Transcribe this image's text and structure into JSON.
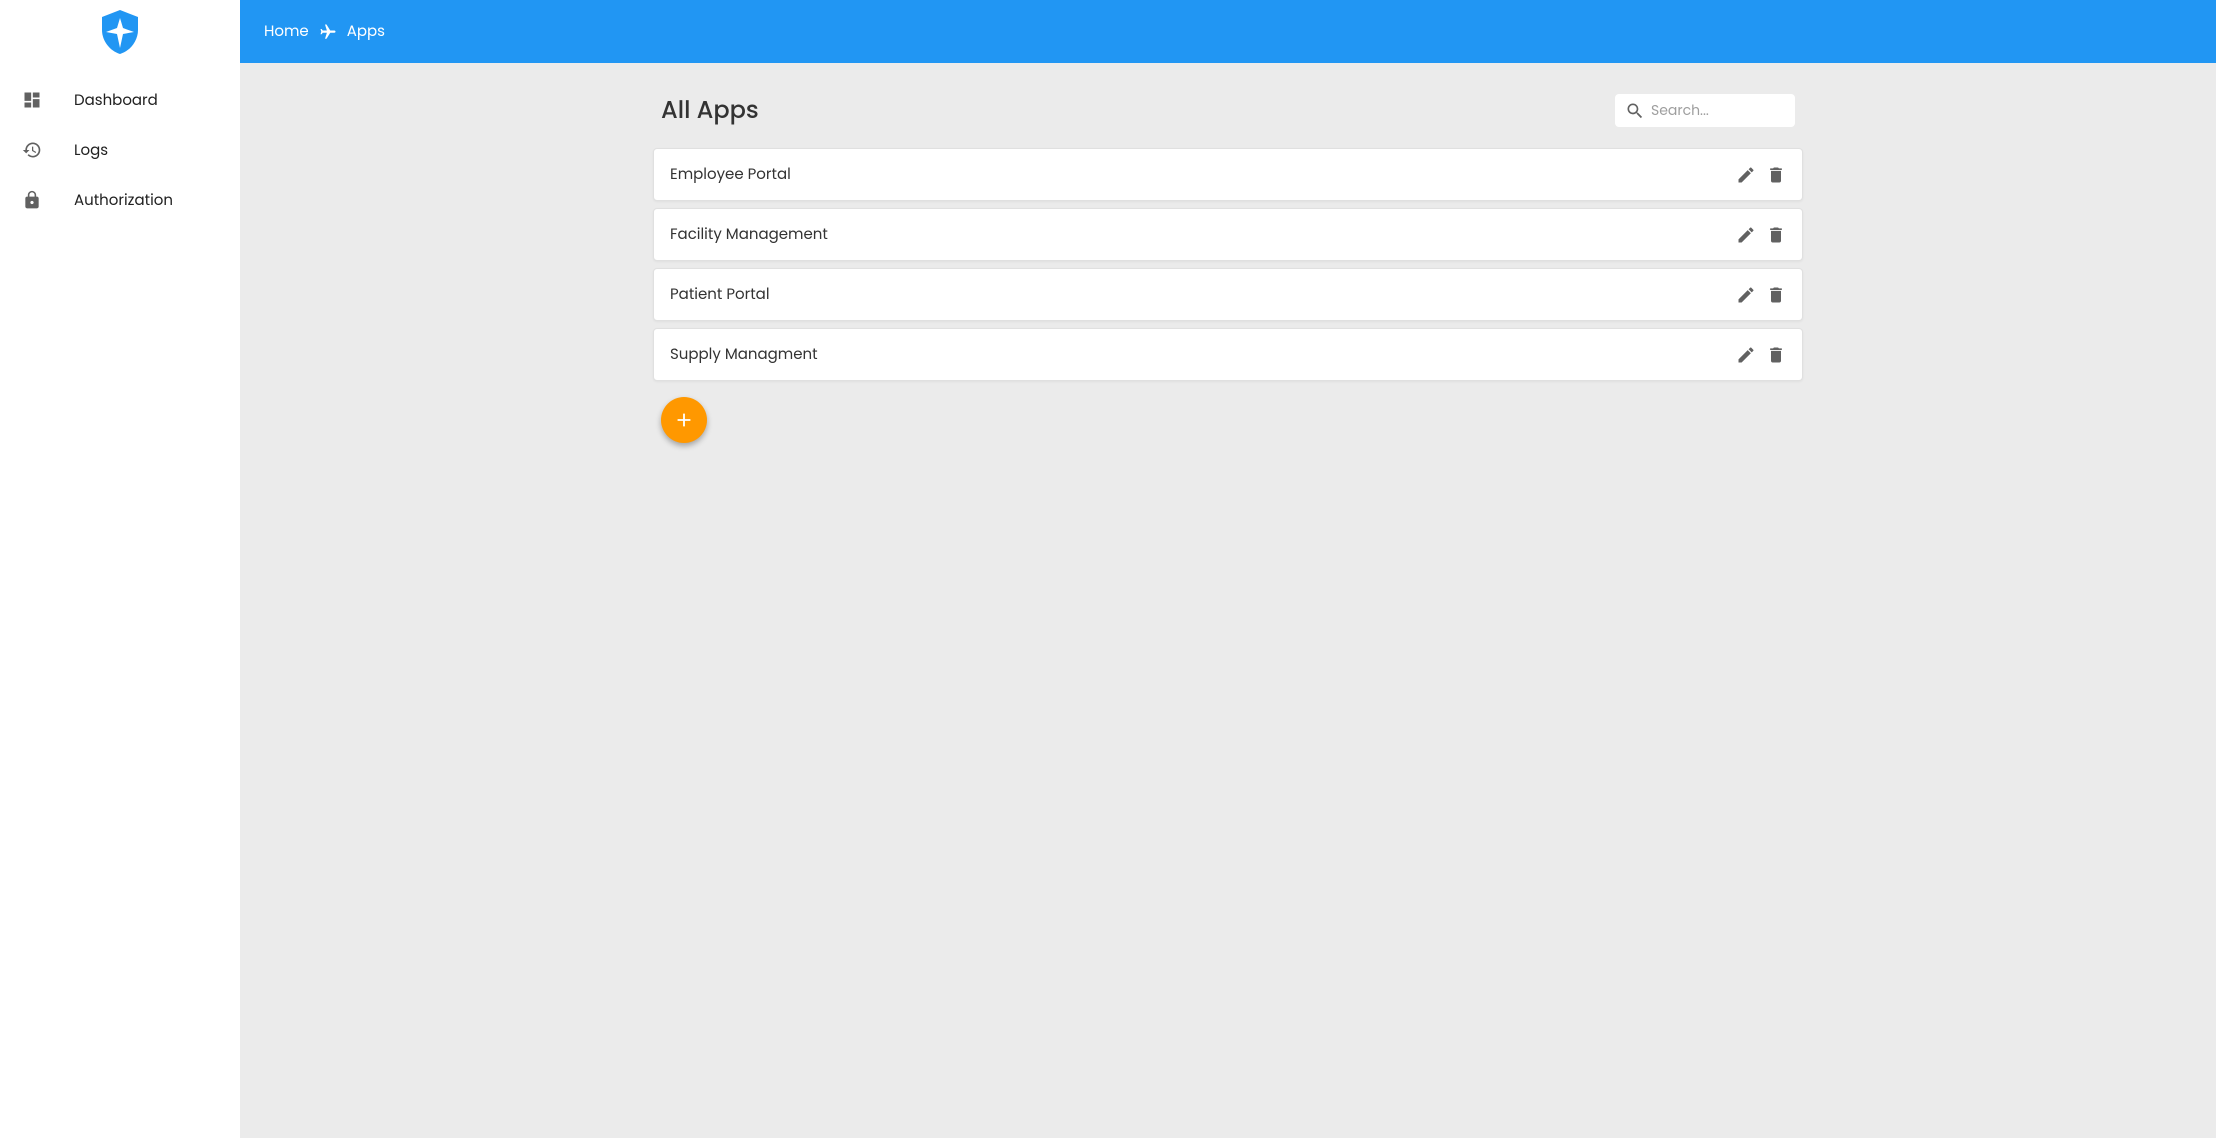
{
  "breadcrumb": {
    "home": "Home",
    "current": "Apps"
  },
  "sidebar": {
    "items": [
      {
        "label": "Dashboard",
        "icon": "dashboard"
      },
      {
        "label": "Logs",
        "icon": "history"
      },
      {
        "label": "Authorization",
        "icon": "lock"
      }
    ]
  },
  "page": {
    "title": "All Apps"
  },
  "search": {
    "placeholder": "Search..."
  },
  "apps": [
    {
      "name": "Employee Portal"
    },
    {
      "name": "Facility Management"
    },
    {
      "name": "Patient Portal"
    },
    {
      "name": "Supply Managment"
    }
  ]
}
